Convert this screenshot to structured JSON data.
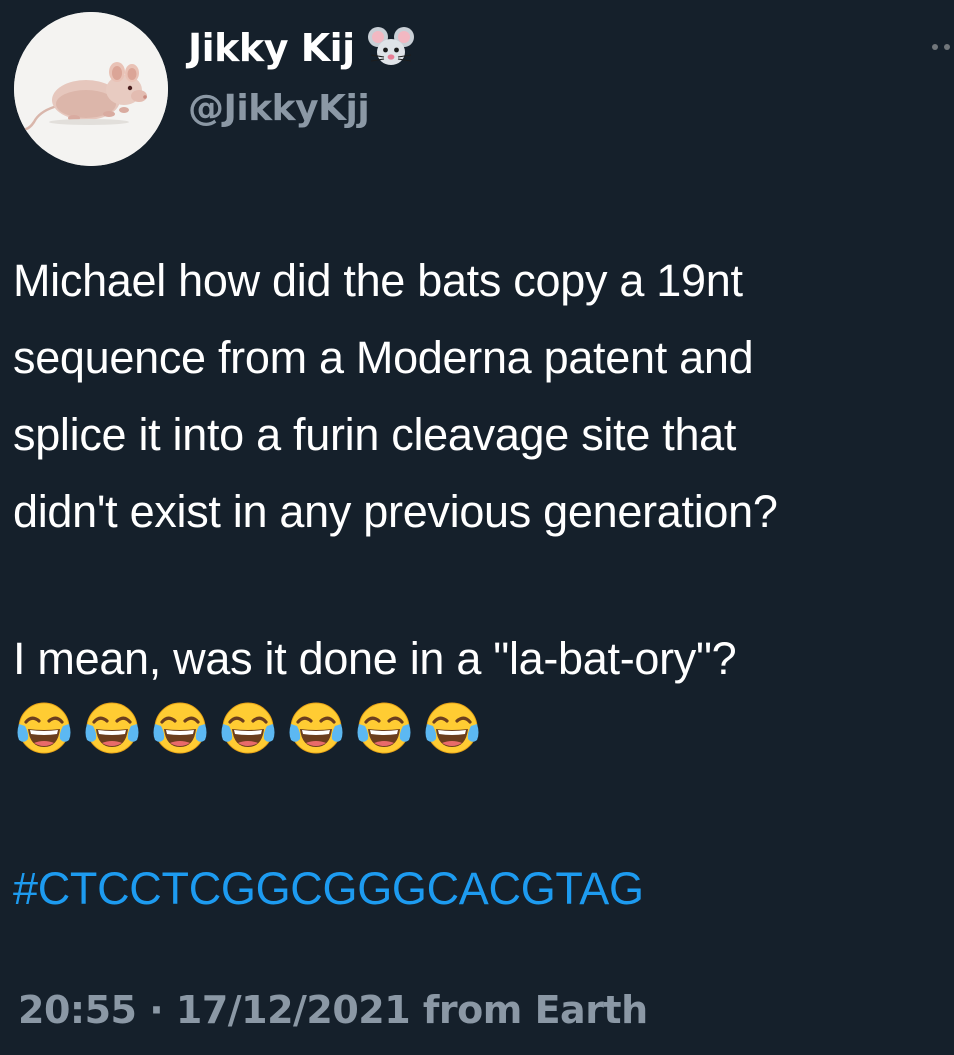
{
  "author": {
    "display_name": "Jikky Kij",
    "handle": "@JikkyKjj",
    "name_emoji": "mouse-face-icon",
    "avatar": "hairless-rat-avatar"
  },
  "tweet": {
    "lines": [
      "Michael how did the bats copy a 19nt",
      "sequence from a Moderna patent and",
      "splice it into a furin cleavage site that",
      "didn't exist in any previous generation?"
    ],
    "second_paragraph": "I mean, was it done in a \"la-bat-ory\"?",
    "emojis": [
      "tears-of-joy-icon",
      "tears-of-joy-icon",
      "tears-of-joy-icon",
      "tears-of-joy-icon",
      "tears-of-joy-icon",
      "tears-of-joy-icon",
      "tears-of-joy-icon"
    ],
    "hashtag": "#CTCCTCGGCGGGCACGTAG"
  },
  "meta": {
    "time": "20:55",
    "separator": "·",
    "date": "17/12/2021",
    "source": "from Earth"
  },
  "colors": {
    "background": "#15202b",
    "text": "#ffffff",
    "secondary": "#8b98a5",
    "link": "#1d9bf0"
  }
}
